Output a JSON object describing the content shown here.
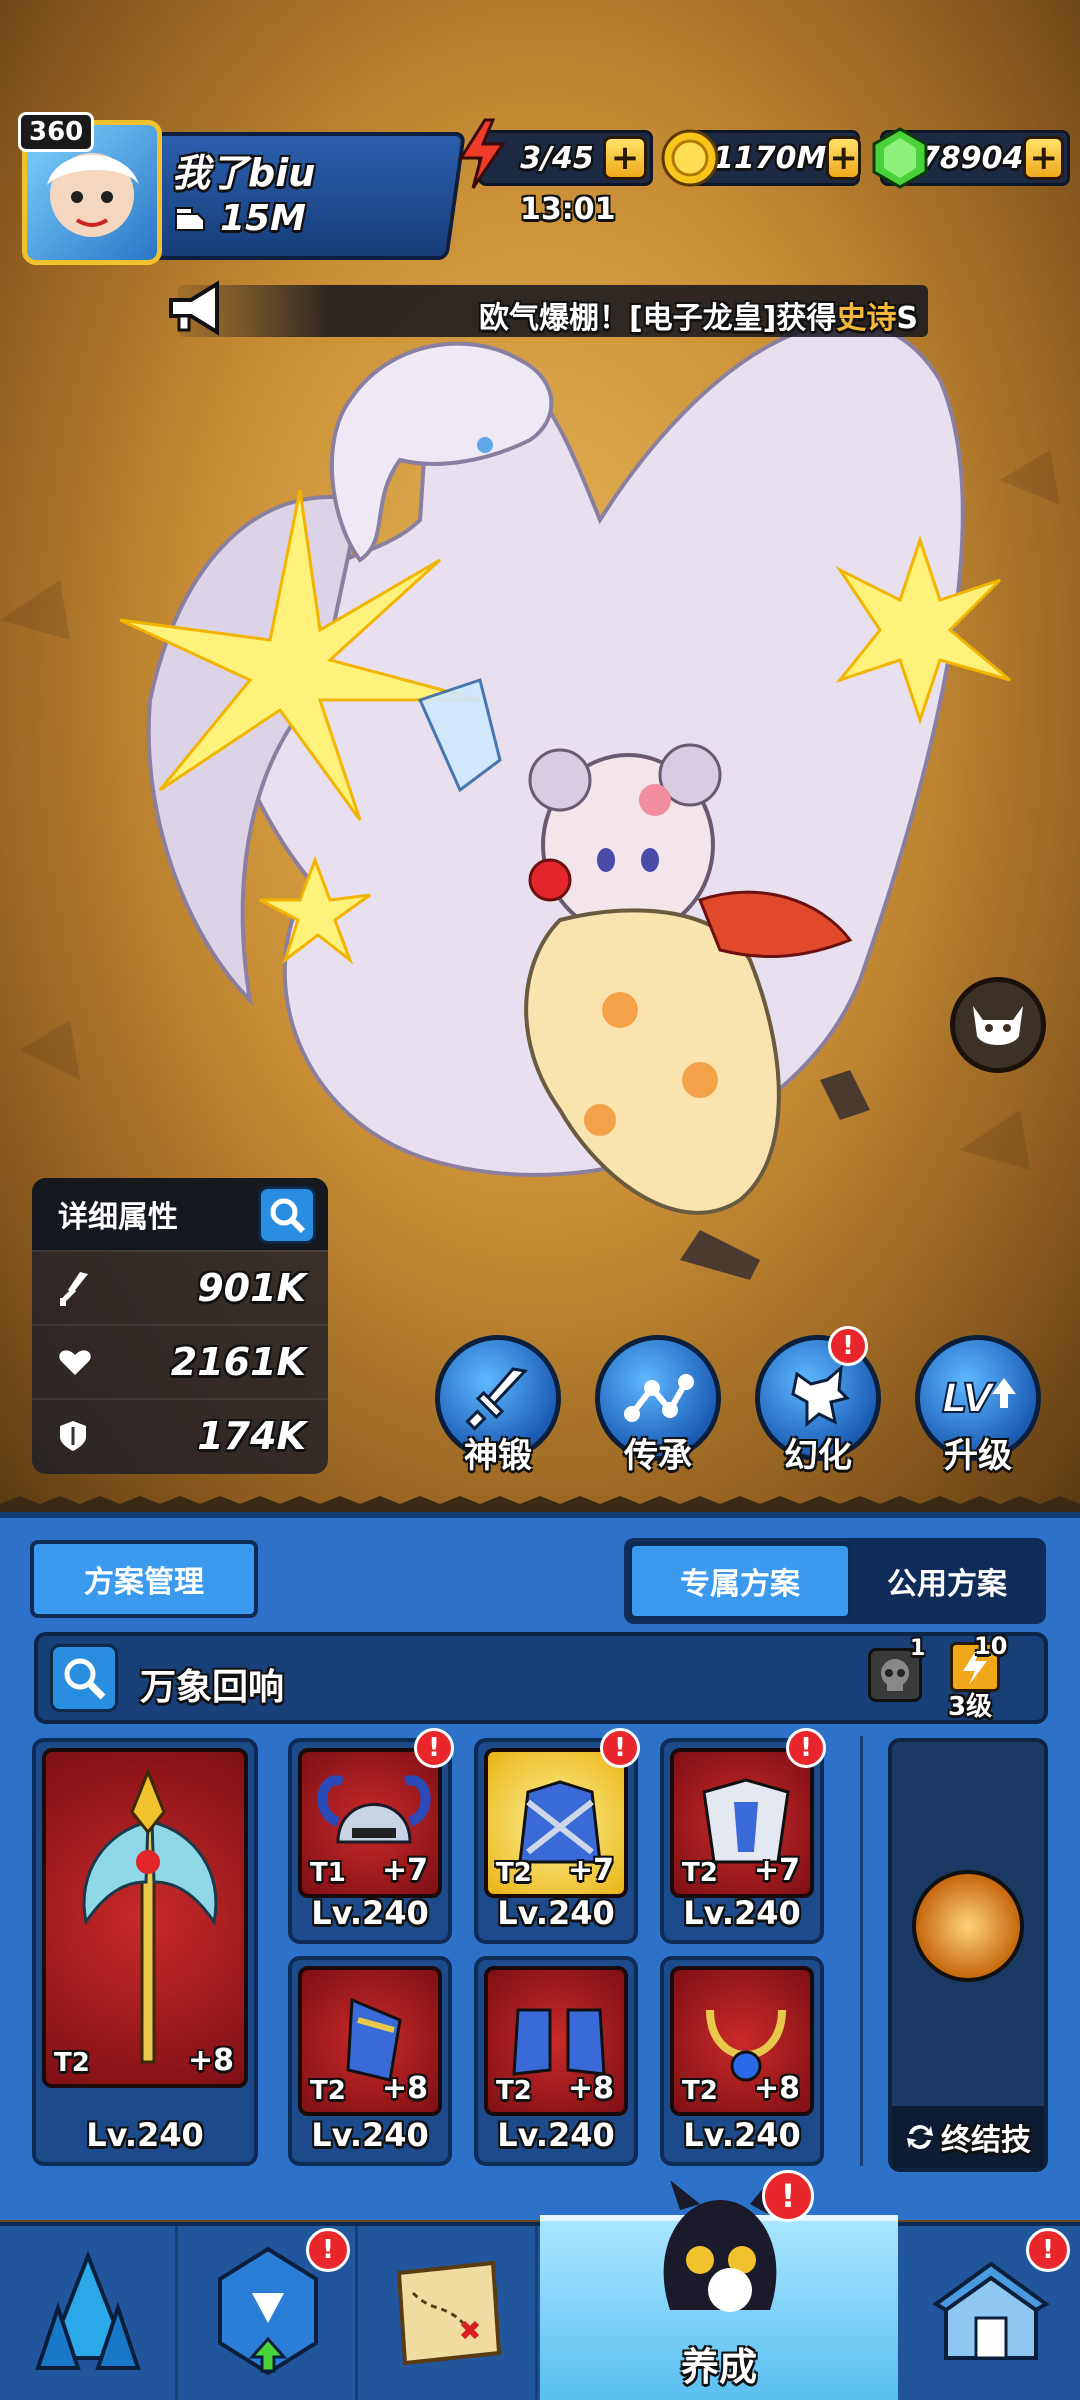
{
  "player": {
    "level": "360",
    "name": "我了biu",
    "power": "15M"
  },
  "resources": {
    "energy": "3/45",
    "energy_timer": "13:01",
    "gold": "1170M",
    "gems": "78904"
  },
  "broadcast": {
    "text_prefix": "欧气爆棚！[电子龙皇]获得",
    "text_highlight": "史诗",
    "text_suffix": "S"
  },
  "stats": {
    "title": "详细属性",
    "attack": "901K",
    "hp": "2161K",
    "defense": "174K"
  },
  "actions": {
    "forge": "神锻",
    "inherit": "传承",
    "transform": "幻化",
    "upgrade": "升级",
    "transform_badge": "!"
  },
  "panel": {
    "manage": "方案管理",
    "exclusive": "专属方案",
    "public": "公用方案",
    "set_name": "万象回响",
    "skull_count": "1",
    "book_count": "10",
    "book_level": "3级",
    "ultimate": "终结技"
  },
  "equipment": {
    "weapon": {
      "tier": "T2",
      "plus": "+8",
      "level": "Lv.240"
    },
    "items": [
      {
        "tier": "T1",
        "plus": "+7",
        "level": "Lv.240",
        "alert": "!"
      },
      {
        "tier": "T2",
        "plus": "+7",
        "level": "Lv.240",
        "alert": "!"
      },
      {
        "tier": "T2",
        "plus": "+7",
        "level": "Lv.240",
        "alert": "!"
      },
      {
        "tier": "T2",
        "plus": "+8",
        "level": "Lv.240"
      },
      {
        "tier": "T2",
        "plus": "+8",
        "level": "Lv.240"
      },
      {
        "tier": "T2",
        "plus": "+8",
        "level": "Lv.240"
      }
    ]
  },
  "nav": {
    "active_label": "养成",
    "badge": "!"
  },
  "colors": {
    "accent_blue": "#2d72c8",
    "alert_red": "#e8262c",
    "gold": "#f2c12e",
    "highlight": "#f5b83a"
  }
}
